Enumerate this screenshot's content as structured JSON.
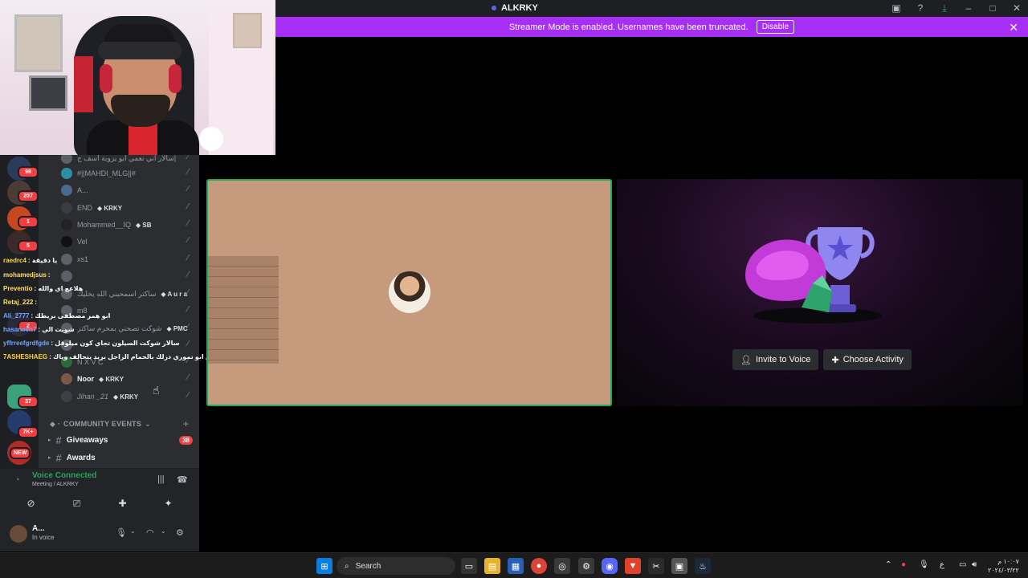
{
  "window": {
    "title": "ALKRKY"
  },
  "banner": {
    "message": "Streamer Mode is enabled. Usernames have been truncated.",
    "disable_label": "Disable"
  },
  "rail": {
    "badges": [
      "98",
      "207",
      "1",
      "5",
      "2",
      "37",
      "7K+"
    ],
    "new_label": "NEW"
  },
  "voice_users": [
    {
      "name": "سالار اني نعمي ابو يزوبة اسف ج|",
      "tag": ""
    },
    {
      "name": "#||MAHDI_MLG||#",
      "tag": ""
    },
    {
      "name": "A...",
      "tag": ""
    },
    {
      "name": "END",
      "tag": "KRKY"
    },
    {
      "name": "Mohammed__IQ",
      "tag": "SB"
    },
    {
      "name": "Vel",
      "tag": ""
    },
    {
      "name": "xs1",
      "tag": ""
    },
    {
      "name": "",
      "tag": ""
    },
    {
      "name": "ساكتر اسمحيني الله يخليك",
      "tag": "A u r a"
    },
    {
      "name": "m8",
      "tag": ""
    },
    {
      "name": "شوكت تصحني بمحرم ساكتر",
      "tag": "PMC"
    },
    {
      "name": "",
      "tag": ""
    },
    {
      "name": "N X V C",
      "tag": ""
    },
    {
      "name": "Noor",
      "tag": "KRKY"
    },
    {
      "name": "Jihan _21",
      "tag": "KRKY"
    }
  ],
  "category": {
    "label": "COMMUNITY EVENTS"
  },
  "channels": [
    {
      "name": "Giveaways",
      "count": "38"
    },
    {
      "name": "Awards",
      "count": ""
    }
  ],
  "chat": [
    {
      "user": "raedrc4",
      "msg": ": يا دقيقة",
      "color": "#ffd43b"
    },
    {
      "user": "mohamedjsus",
      "msg": ":",
      "color": "#ffe066"
    },
    {
      "user": "Preventio",
      "msg": ": هلاعع اي والله",
      "color": "#ffe066"
    },
    {
      "user": "Retaj_222",
      "msg": ":",
      "color": "#ffe066"
    },
    {
      "user": "Ali_2777",
      "msg": ": ابو همر مصطفى بريطك",
      "color": "#6ea8fe"
    },
    {
      "user": "hasaneen7",
      "msg": ": شويت الي",
      "color": "#6ea8fe"
    },
    {
      "user": "yffrreefgrdfgde",
      "msg": ": سالار شوكت السيلون تجاي كون ميلوقل",
      "color": "#6ea8fe"
    },
    {
      "user": "7ASHESHAEG",
      "msg": ": ابو همر اسمع ابو نموري دزلك بالحمام الزاجل بريد يتحالف وياك",
      "color": "#ffd43b"
    }
  ],
  "voice_panel": {
    "status": "Voice Connected",
    "location": "Meeting / ALKRKY"
  },
  "user_panel": {
    "name": "A...",
    "status": "In voice"
  },
  "activity": {
    "invite_label": "Invite to Voice",
    "choose_label": "Choose Activity"
  },
  "taskbar": {
    "search_label": "Search",
    "time": "١٠:٠٧ م",
    "date": "٢٠٢٤/٠٣/٢٢",
    "lang": "ع"
  }
}
